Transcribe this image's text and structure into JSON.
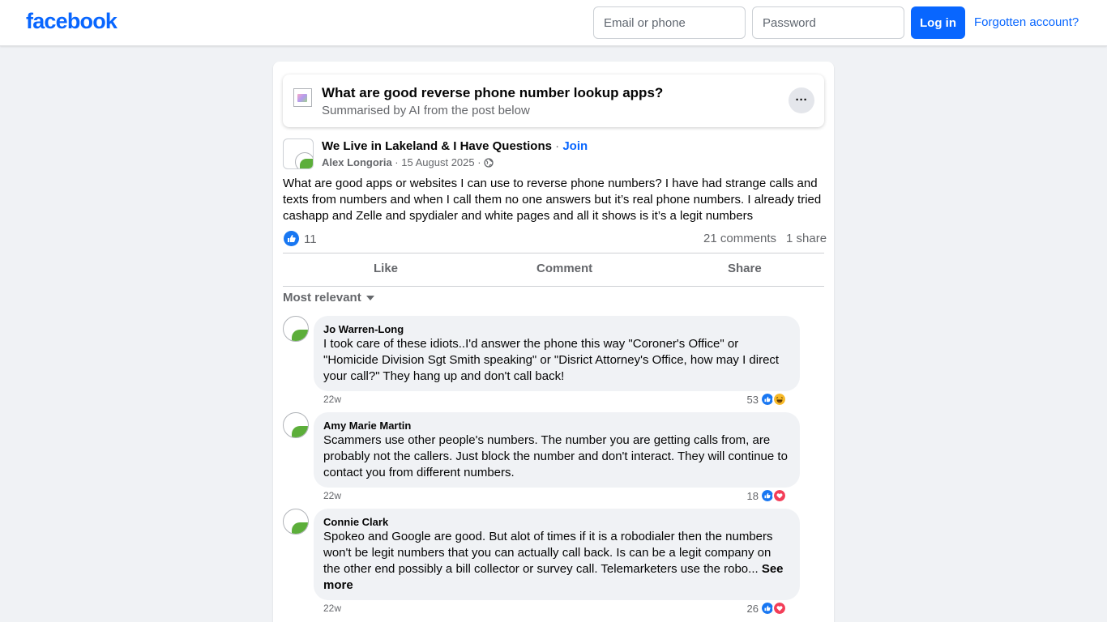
{
  "header": {
    "logo": "facebook",
    "email_placeholder": "Email or phone",
    "password_placeholder": "Password",
    "login_label": "Log in",
    "forgot_label": "Forgotten account?"
  },
  "ai_summary": {
    "title": "What are good reverse phone number lookup apps?",
    "subtitle": "Summarised by AI from the post below",
    "more_label": "···"
  },
  "post": {
    "group_name": "We Live in Lakeland & I Have Questions",
    "separator": " · ",
    "join_label": "Join",
    "author": "Alex Longoria",
    "date": "15 August 2025",
    "privacy_icon": "globe-icon",
    "text": "What are good apps or websites I can use to reverse phone numbers? I have had strange calls and texts from numbers and when I call them no one answers but it’s real phone numbers. I already tried cashapp and Zelle and spydialer and white pages and all it shows is it’s a legit numbers",
    "reaction_count": "11",
    "comments_count": "21 comments",
    "shares_count": "1 share"
  },
  "actions": {
    "like": "Like",
    "comment": "Comment",
    "share": "Share"
  },
  "sort": {
    "label": "Most relevant"
  },
  "comments": [
    {
      "name": "Jo Warren-Long",
      "text": "I took care of these idiots..I'd answer the phone this way \"Coroner's Office\" or \"Homicide Division Sgt Smith speaking\" or \"Disrict Attorney's Office, how may I direct your call?\" They hang up and don't call back!",
      "time": "22w",
      "reactions": "53",
      "reaction_types": [
        "like",
        "haha"
      ]
    },
    {
      "name": "Amy Marie Martin",
      "text": "Scammers use other people's numbers. The number you are getting calls from, are probably not the callers. Just block the number and don't interact. They will continue to contact you from different numbers.",
      "time": "22w",
      "reactions": "18",
      "reaction_types": [
        "like",
        "love"
      ]
    },
    {
      "name": "Connie Clark",
      "text": "Spokeo and Google are good. But alot of times if it is a robodialer then the numbers won't be legit numbers that you can actually call back. Is can be a legit company on the other end possibly a bill collector or survey call. Telemarketers use the robo... ",
      "see_more": "See more",
      "time": "22w",
      "reactions": "26",
      "reaction_types": [
        "like",
        "love"
      ]
    }
  ],
  "colors": {
    "brand_blue": "#0866ff",
    "background": "#f0f2f5",
    "secondary_text": "#65676b"
  }
}
